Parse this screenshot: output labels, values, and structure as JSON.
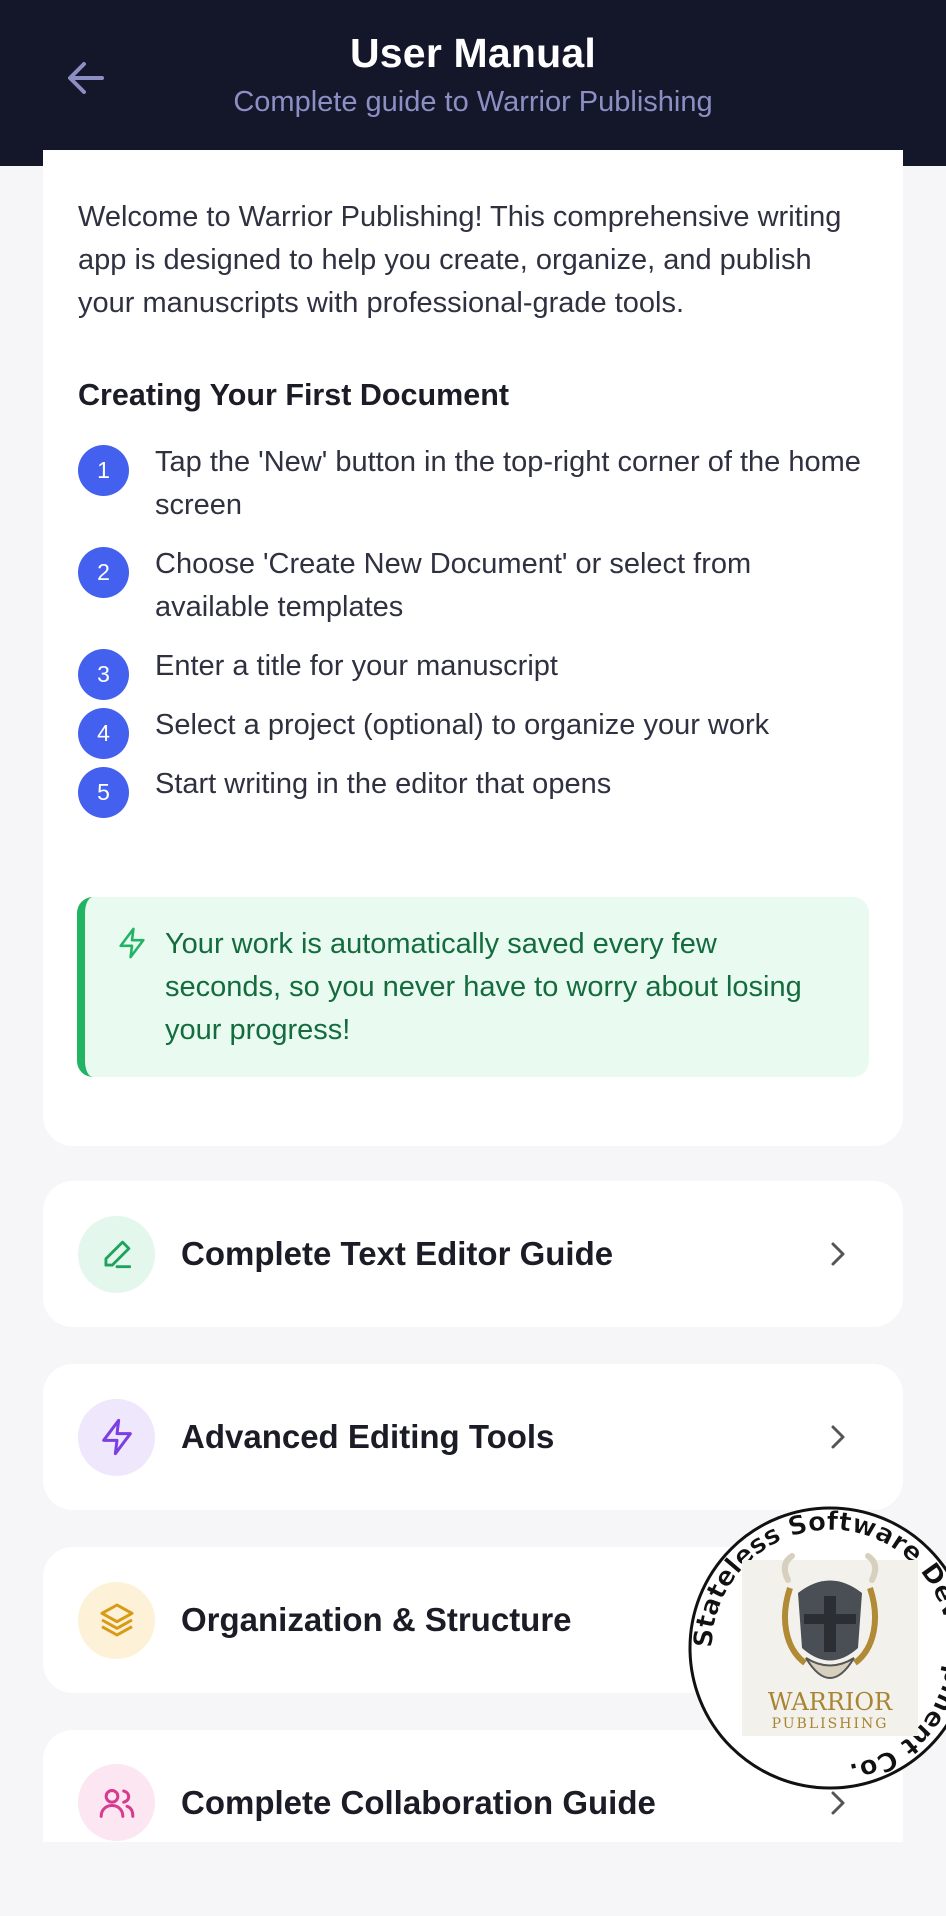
{
  "header": {
    "title": "User Manual",
    "subtitle": "Complete guide to Warrior Publishing",
    "back_icon": "arrow-left-icon"
  },
  "intro": {
    "text": "Welcome to Warrior Publishing! This comprehensive writing app is designed to help you create, organize, and publish your manuscripts with professional-grade tools.",
    "heading": "Creating Your First Document",
    "steps": [
      {
        "num": "1",
        "text": "Tap the 'New' button in the top-right corner of the home screen"
      },
      {
        "num": "2",
        "text": "Choose 'Create New Document' or select from available templates"
      },
      {
        "num": "3",
        "text": "Enter a title for your manuscript"
      },
      {
        "num": "4",
        "text": "Select a project (optional) to organize your work"
      },
      {
        "num": "5",
        "text": "Start writing in the editor that opens"
      }
    ],
    "tip": {
      "icon": "lightning-icon",
      "text": "Your work is automatically saved every few seconds, so you never have to worry about losing your progress!"
    }
  },
  "guides": [
    {
      "label": "Complete Text Editor Guide",
      "icon": "pencil-icon",
      "color": "#1fa35c",
      "bg": "#e4f7ec"
    },
    {
      "label": "Advanced Editing Tools",
      "icon": "lightning-icon",
      "color": "#7b3fe4",
      "bg": "#efe7fb"
    },
    {
      "label": "Organization & Structure",
      "icon": "layers-icon",
      "color": "#d99a16",
      "bg": "#fdf1d8"
    },
    {
      "label": "Complete Collaboration Guide",
      "icon": "users-icon",
      "color": "#d83a8f",
      "bg": "#fbe6f1"
    }
  ],
  "stamp": {
    "ring_text": "Stateless Software Development Co.",
    "logo_text": "WARRIOR",
    "logo_subtext": "PUBLISHING"
  },
  "colors": {
    "header_bg": "#14162a",
    "accent_blue": "#4361ee",
    "tip_green": "#22b363"
  }
}
